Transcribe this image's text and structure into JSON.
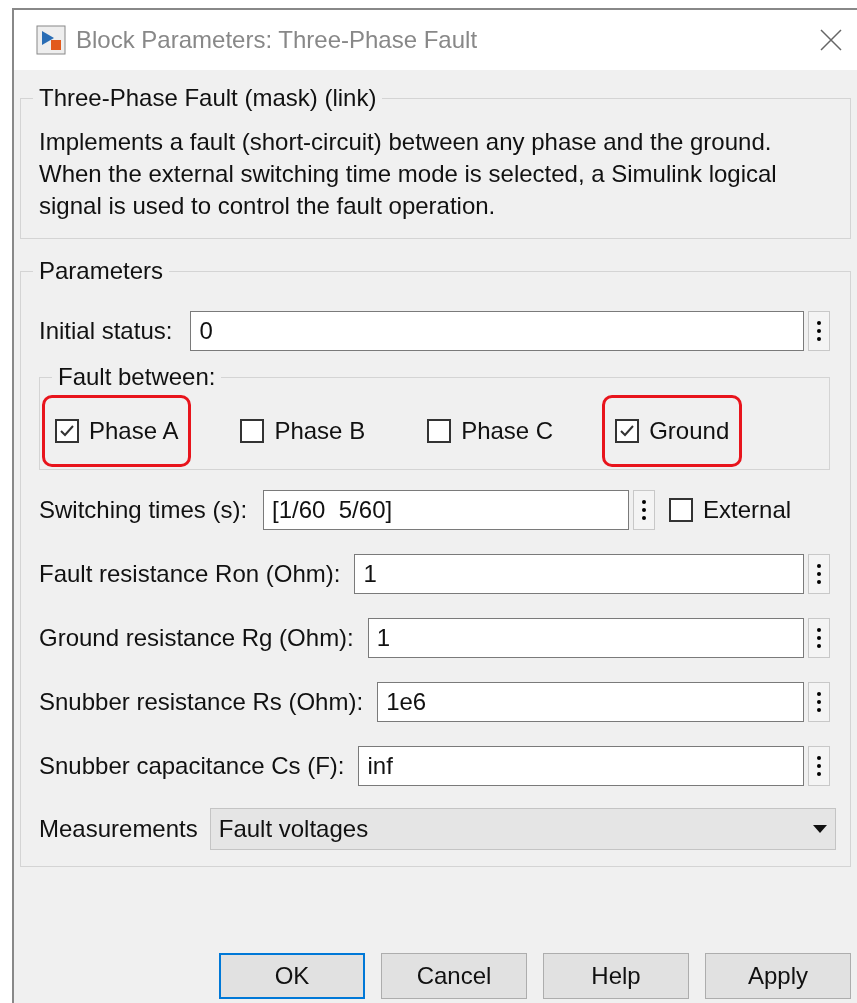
{
  "window": {
    "title": "Block Parameters: Three-Phase Fault"
  },
  "description": {
    "title": "Three-Phase Fault (mask) (link)",
    "text": "Implements a fault (short-circuit) between any phase and the ground. When the external switching time mode is selected, a Simulink logical signal is used to control the fault operation."
  },
  "parameters": {
    "title": "Parameters",
    "initial_status": {
      "label": "Initial status:",
      "value": "0"
    },
    "fault_between": {
      "title": "Fault between:",
      "options": [
        {
          "label": "Phase A",
          "checked": true,
          "highlighted": true
        },
        {
          "label": "Phase B",
          "checked": false,
          "highlighted": false
        },
        {
          "label": "Phase C",
          "checked": false,
          "highlighted": false
        },
        {
          "label": "Ground",
          "checked": true,
          "highlighted": true
        }
      ]
    },
    "switching_times": {
      "label": "Switching times (s):",
      "value": "[1/60  5/60]",
      "external": {
        "label": "External",
        "checked": false
      }
    },
    "fields": [
      {
        "label": "Fault resistance Ron (Ohm):",
        "value": "1"
      },
      {
        "label": "Ground resistance Rg (Ohm):",
        "value": "1"
      },
      {
        "label": "Snubber resistance Rs (Ohm):",
        "value": "1e6"
      },
      {
        "label": "Snubber capacitance Cs (F):",
        "value": "inf"
      }
    ],
    "measurements": {
      "label": "Measurements",
      "value": "Fault voltages"
    }
  },
  "buttons": [
    {
      "label": "OK",
      "selected": true
    },
    {
      "label": "Cancel",
      "selected": false
    },
    {
      "label": "Help",
      "selected": false
    },
    {
      "label": "Apply",
      "selected": false
    }
  ]
}
